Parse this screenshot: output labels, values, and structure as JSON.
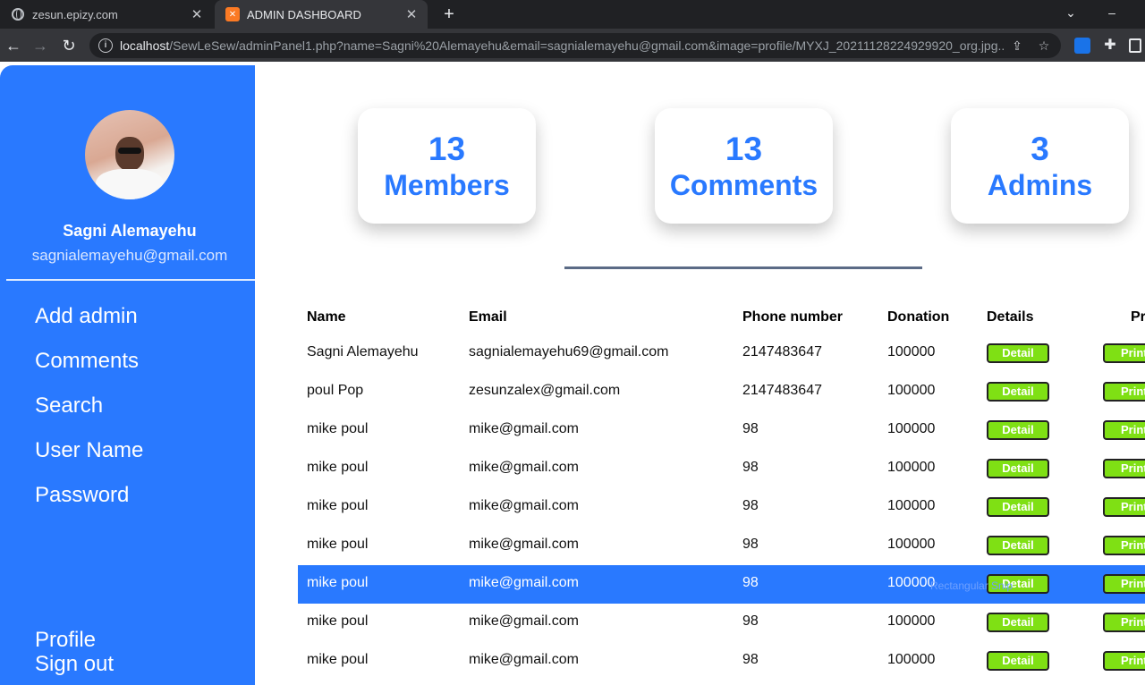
{
  "browser": {
    "tabs": [
      {
        "title": "zesun.epizy.com",
        "active": false,
        "icon": "globe-icon"
      },
      {
        "title": "ADMIN DASHBOARD",
        "active": true,
        "icon": "xampp-icon"
      }
    ],
    "url_host": "localhost",
    "url_path": "/SewLeSew/adminPanel1.php?name=Sagni%20Alemayehu&email=sagnialemayehu@gmail.com&image=profile/MYXJ_20211128224929920_org.jpg..."
  },
  "sidebar": {
    "user_name": "Sagni Alemayehu",
    "user_email": "sagnialemayehu@gmail.com",
    "nav": [
      "Add admin",
      "Comments",
      "Search",
      "User Name",
      "Password"
    ],
    "bottom": [
      "Profile",
      "Sign out"
    ],
    "accent": "#2979ff"
  },
  "stats": [
    {
      "value": "13",
      "label": "Members"
    },
    {
      "value": "13",
      "label": "Comments"
    },
    {
      "value": "3",
      "label": "Admins"
    }
  ],
  "table": {
    "headers": [
      "Name",
      "Email",
      "Phone number",
      "Donation",
      "Details",
      "Pr"
    ],
    "detail_label": "Detail",
    "print_label": "Print",
    "rows": [
      {
        "name": "Sagni Alemayehu",
        "email": "sagnialemayehu69@gmail.com",
        "phone": "2147483647",
        "donation": "100000"
      },
      {
        "name": "poul Pop",
        "email": "zesunzalex@gmail.com",
        "phone": "2147483647",
        "donation": "100000"
      },
      {
        "name": "mike poul",
        "email": "mike@gmail.com",
        "phone": "98",
        "donation": "100000"
      },
      {
        "name": "mike poul",
        "email": "mike@gmail.com",
        "phone": "98",
        "donation": "100000"
      },
      {
        "name": "mike poul",
        "email": "mike@gmail.com",
        "phone": "98",
        "donation": "100000"
      },
      {
        "name": "mike poul",
        "email": "mike@gmail.com",
        "phone": "98",
        "donation": "100000"
      },
      {
        "name": "mike poul",
        "email": "mike@gmail.com",
        "phone": "98",
        "donation": "100000"
      },
      {
        "name": "mike poul",
        "email": "mike@gmail.com",
        "phone": "98",
        "donation": "100000"
      },
      {
        "name": "mike poul",
        "email": "mike@gmail.com",
        "phone": "98",
        "donation": "100000"
      }
    ],
    "highlighted_row": 6,
    "button_color": "#7fe014"
  },
  "overlay_hint": "Rectangular Snip"
}
